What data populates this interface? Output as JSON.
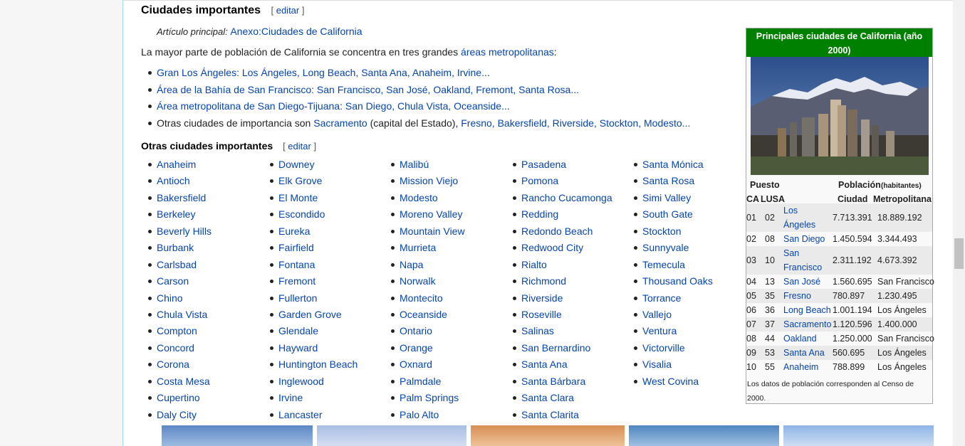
{
  "section": {
    "title": "Ciudades importantes",
    "edit_label": "editar",
    "hatnote_prefix": "Artículo principal:",
    "hatnote_link": "Anexo:Ciudades de California",
    "intro_text": "La mayor parte de población de California se concentra en tres grandes ",
    "intro_link": "áreas metropolitanas",
    "intro_end": ":"
  },
  "metro_areas": [
    {
      "link": "Gran Los Ángeles",
      "rest": ": Los Ángeles, Long Beach, Santa Ana, Anaheim, Irvine..."
    },
    {
      "link": "Área de la Bahía de San Francisco",
      "rest": ": San Francisco, San José, Oakland, Fremont, Santa Rosa..."
    },
    {
      "link": "Área metropolitana de San Diego-Tijuana",
      "rest": ": San Diego, Chula Vista, Oceanside..."
    }
  ],
  "other_line": {
    "prefix": "Otras ciudades de importancia son ",
    "link1": "Sacramento",
    "middle": " (capital del Estado), ",
    "link2": "Fresno, Bakersfield, Riverside, Stockton, Modesto..."
  },
  "subsection": {
    "title": "Otras ciudades importantes",
    "edit_label": "editar"
  },
  "city_columns": [
    [
      "Anaheim",
      "Antioch",
      "Bakersfield",
      "Berkeley",
      "Beverly Hills",
      "Burbank",
      "Carlsbad",
      "Carson",
      "Chino",
      "Chula Vista",
      "Compton",
      "Concord",
      "Corona",
      "Costa Mesa",
      "Cupertino",
      "Daly City"
    ],
    [
      "Downey",
      "Elk Grove",
      "El Monte",
      "Escondido",
      "Eureka",
      "Fairfield",
      "Fontana",
      "Fremont",
      "Fullerton",
      "Garden Grove",
      "Glendale",
      "Hayward",
      "Huntington Beach",
      "Inglewood",
      "Irvine",
      "Lancaster"
    ],
    [
      "Malibú",
      "Mission Viejo",
      "Modesto",
      "Moreno Valley",
      "Mountain View",
      "Murrieta",
      "Napa",
      "Norwalk",
      "Montecito",
      "Oceanside",
      "Ontario",
      "Orange",
      "Oxnard",
      "Palmdale",
      "Palm Springs",
      "Palo Alto"
    ],
    [
      "Pasadena",
      "Pomona",
      "Rancho Cucamonga",
      "Redding",
      "Redondo Beach",
      "Redwood City",
      "Rialto",
      "Richmond",
      "Riverside",
      "Roseville",
      "Salinas",
      "San Bernardino",
      "Santa Ana",
      "Santa Bárbara",
      "Santa Clara",
      "Santa Clarita"
    ],
    [
      "Santa Mónica",
      "Santa Rosa",
      "Simi Valley",
      "South Gate",
      "Stockton",
      "Sunnyvale",
      "Temecula",
      "Thousand Oaks",
      "Torrance",
      "Vallejo",
      "Ventura",
      "Victorville",
      "Visalia",
      "West Covina"
    ]
  ],
  "infobox": {
    "title": "Principales ciudades de California (año 2000)",
    "header_puesto": "Puesto",
    "header_poblacion": "Población",
    "header_habitantes": "(habitantes)",
    "header_ca": "CA",
    "header_usa": "LUSA",
    "header_ciudad": "Ciudad",
    "header_metro": "Metropolitana",
    "rows": [
      {
        "ca": "01",
        "usa": "02",
        "city": "Los Ángeles",
        "pop": "7.713.391",
        "metro": "18.889.192"
      },
      {
        "ca": "02",
        "usa": "08",
        "city": "San Diego",
        "pop": "1.450.594",
        "metro": "3.344.493"
      },
      {
        "ca": "03",
        "usa": "10",
        "city": "San Francisco",
        "pop": "2.311.192",
        "metro": "4.673.392"
      },
      {
        "ca": "04",
        "usa": "13",
        "city": "San José",
        "pop": "1.560.695",
        "metro": "San Francisco"
      },
      {
        "ca": "05",
        "usa": "35",
        "city": "Fresno",
        "pop": "780.897",
        "metro": "1.230.495"
      },
      {
        "ca": "06",
        "usa": "36",
        "city": "Long Beach",
        "pop": "1.001.194",
        "metro": "Los Ángeles"
      },
      {
        "ca": "07",
        "usa": "37",
        "city": "Sacramento",
        "pop": "1.120.596",
        "metro": "1.400.000"
      },
      {
        "ca": "08",
        "usa": "44",
        "city": "Oakland",
        "pop": "1.250.000",
        "metro": "San Francisco"
      },
      {
        "ca": "09",
        "usa": "53",
        "city": "Santa Ana",
        "pop": "560.695",
        "metro": "Los Ángeles"
      },
      {
        "ca": "10",
        "usa": "55",
        "city": "Anaheim",
        "pop": "788.899",
        "metro": "Los Ángeles"
      }
    ],
    "footnote": "Los datos de población corresponden al Censo de 2000."
  },
  "colors": {
    "link": "#0645ad",
    "infobox_title_bg": "#008000"
  }
}
